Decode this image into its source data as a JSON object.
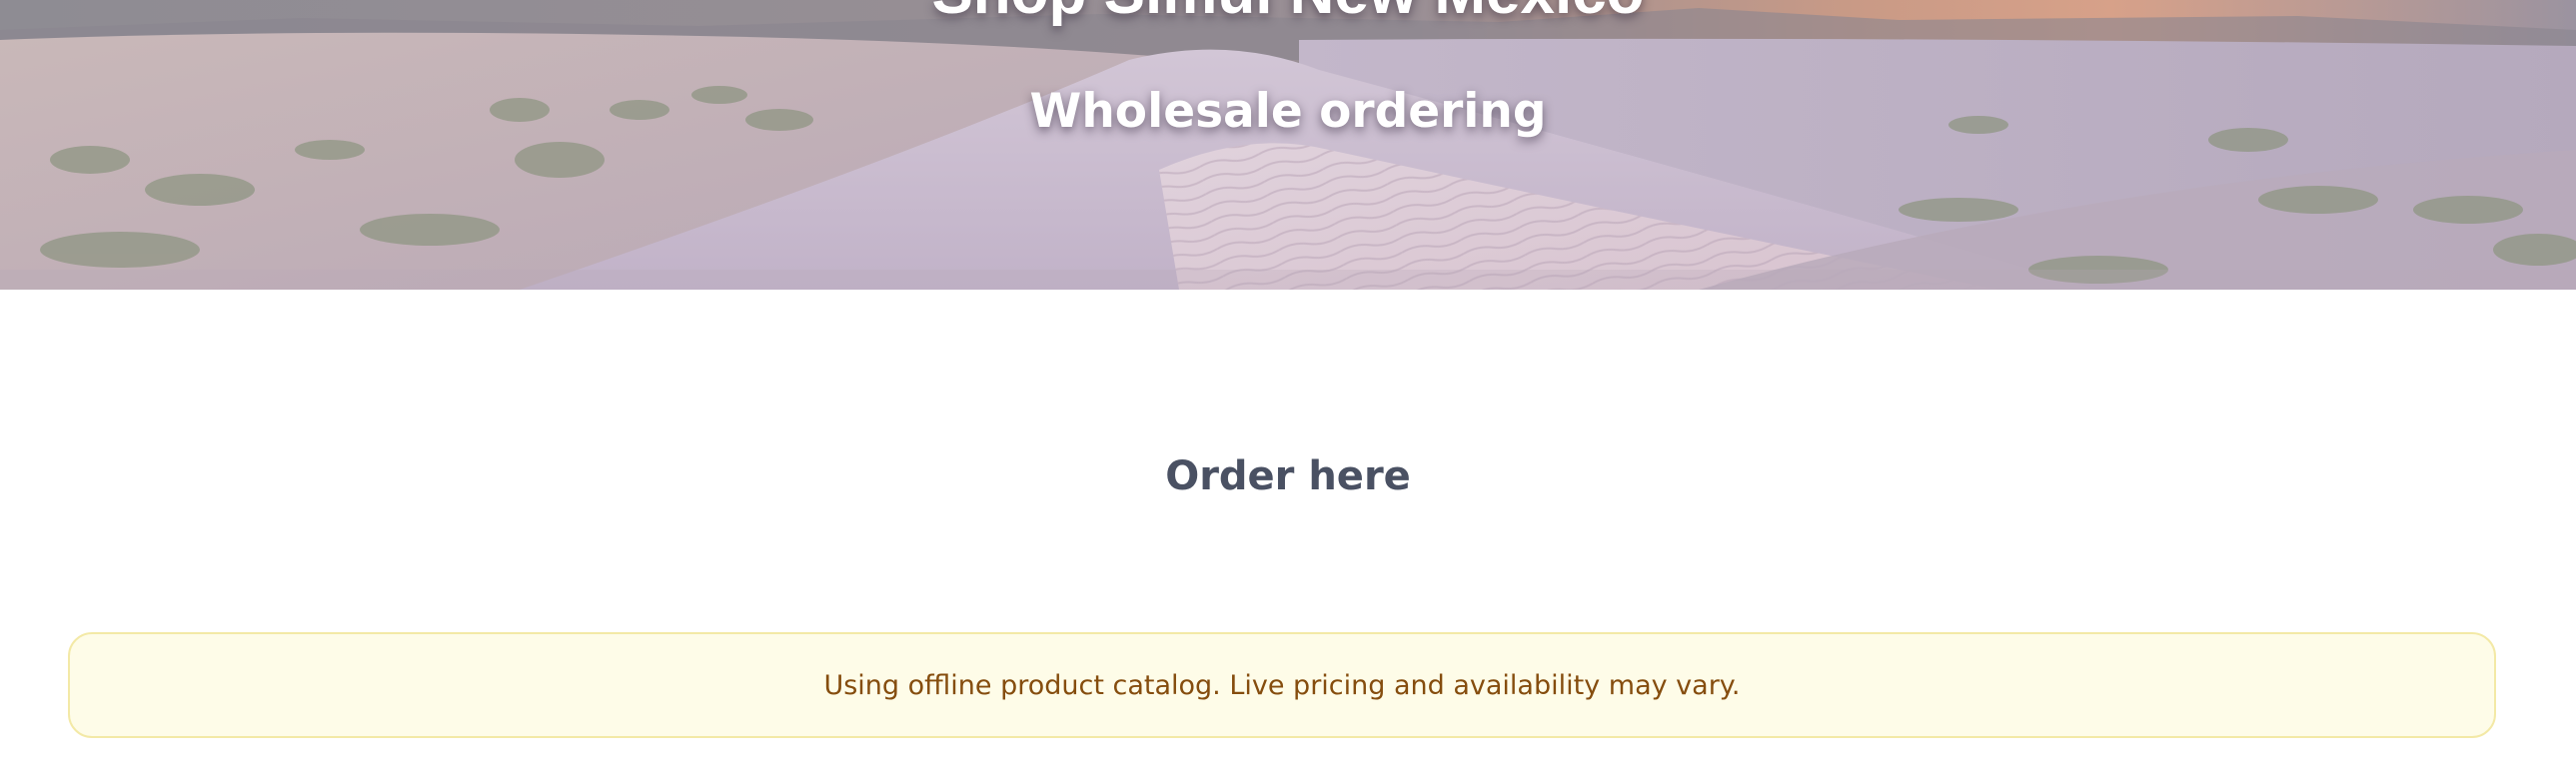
{
  "hero": {
    "title": "Shop Simul New Mexico",
    "subtitle": "Wholesale ordering",
    "background": "white-sands-dunes-image"
  },
  "order": {
    "heading": "Order here"
  },
  "notice": {
    "message": "Using offline product catalog. Live pricing and availability may vary.",
    "colors": {
      "background": "#fefce8",
      "border": "#f3e9a6",
      "text": "#854d0e"
    }
  },
  "colors": {
    "heading_text": "#4a5163",
    "hero_text": "#ffffff"
  }
}
